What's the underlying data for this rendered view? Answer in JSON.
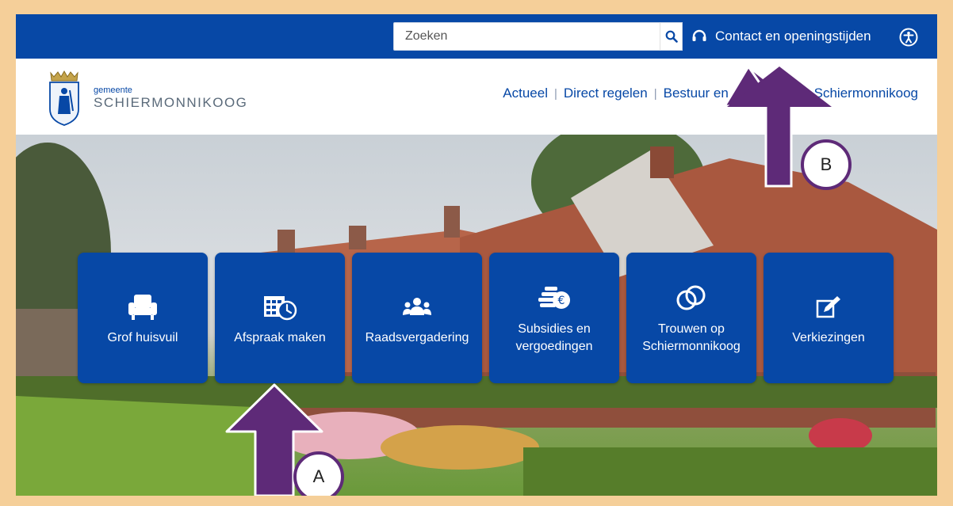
{
  "search": {
    "placeholder": "Zoeken"
  },
  "topbar": {
    "contact_label": "Contact en openingstijden"
  },
  "logo": {
    "small": "gemeente",
    "big": "SCHIERMONNIKOOG"
  },
  "nav": {
    "items": [
      "Actueel",
      "Direct regelen",
      "Bestuur en organisatie",
      "Schiermonnikoog"
    ]
  },
  "tiles": [
    {
      "label": "Grof huisvuil",
      "icon": "armchair-icon"
    },
    {
      "label": "Afspraak maken",
      "icon": "calendar-clock-icon"
    },
    {
      "label": "Raadsvergadering",
      "icon": "council-meeting-icon"
    },
    {
      "label": "Subsidies en vergoedingen",
      "icon": "coins-euro-icon"
    },
    {
      "label": "Trouwen op Schiermonnikoog",
      "icon": "wedding-rings-icon"
    },
    {
      "label": "Verkiezingen",
      "icon": "pencil-icon"
    }
  ],
  "annotations": {
    "a": "A",
    "b": "B"
  },
  "colors": {
    "brand_blue": "#0748a6",
    "annotation_purple": "#5e2a78",
    "frame": "#f5cf99"
  }
}
